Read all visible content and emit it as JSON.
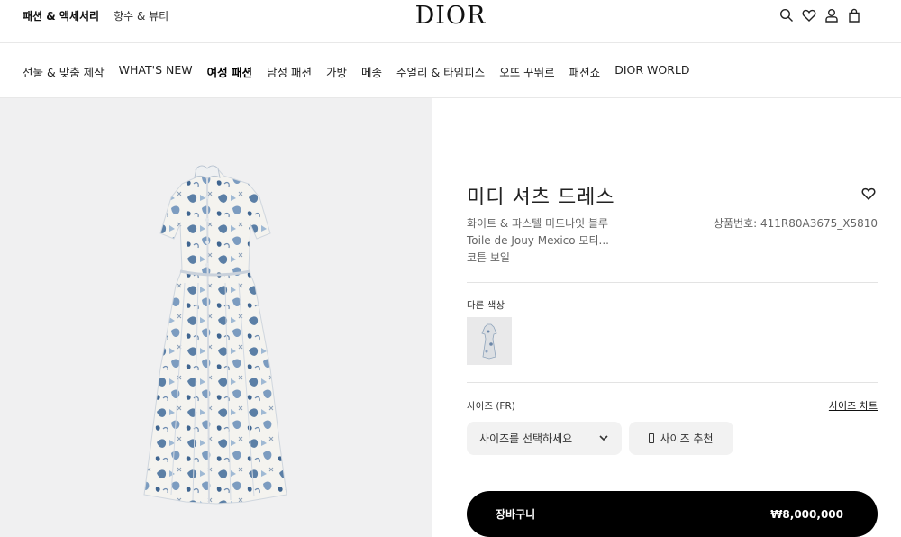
{
  "header": {
    "left_links": [
      "패션 & 액세서리",
      "향수 & 뷰티"
    ],
    "logo": "DIOR",
    "icons": [
      "search-icon",
      "heart-icon",
      "user-icon",
      "bag-icon"
    ]
  },
  "nav": {
    "items": [
      "선물 & 맞춤 제작",
      "WHAT'S NEW",
      "여성 패션",
      "남성 패션",
      "가방",
      "메종",
      "주얼리 & 타임피스",
      "오뜨 꾸뛰르",
      "패션쇼",
      "DIOR WORLD"
    ]
  },
  "product": {
    "title": "미디 셔츠 드레스",
    "description_lines": [
      "화이트 & 파스텔 미드나잇 블루",
      "Toile de Jouy Mexico 모티...",
      "코튼 보일"
    ],
    "sku": "상품번호: 411R80A3675_X5810",
    "other_colors_label": "다른 색상",
    "size_label": "사이즈 (FR)",
    "size_chart_label": "사이즈 차트",
    "size_select_placeholder": "사이즈를 선택하세요",
    "size_recommend_label": "사이즈 추천",
    "cart_label": "장바구니",
    "price": "₩8,000,000"
  },
  "colors": {
    "accent": "#000000",
    "print_blue": "#5b7fa6",
    "print_light": "#9fb9d4",
    "fabric": "#f4f3ef"
  }
}
